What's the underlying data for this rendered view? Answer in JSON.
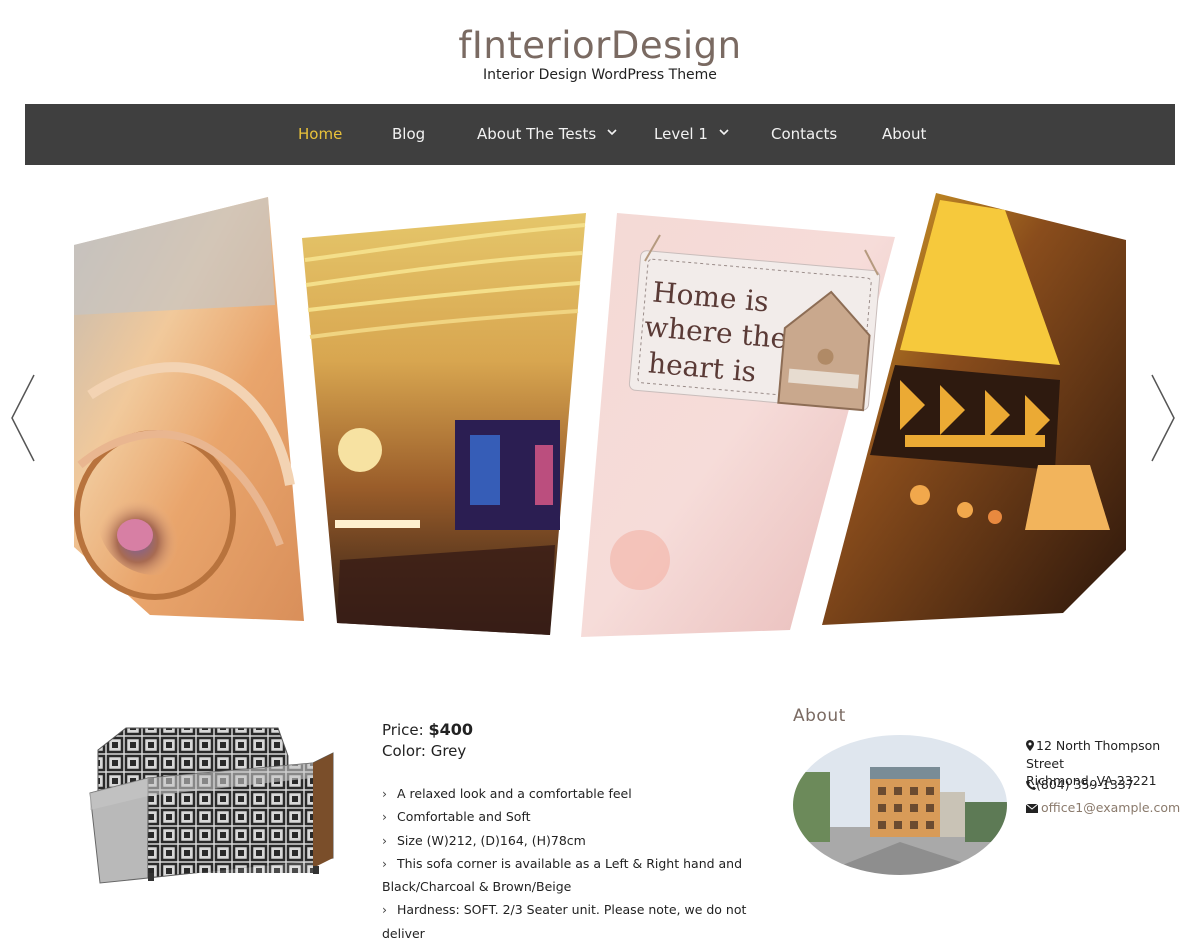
{
  "site": {
    "title": "fInteriorDesign",
    "tagline": "Interior Design WordPress Theme"
  },
  "nav": {
    "items": [
      {
        "label": "Home",
        "active": true
      },
      {
        "label": "Blog"
      },
      {
        "label": "About The Tests",
        "has_submenu": true
      },
      {
        "label": "Level 1",
        "has_submenu": true
      },
      {
        "label": "Contacts"
      },
      {
        "label": "About"
      }
    ]
  },
  "slider": {
    "slides": [
      {
        "name": "spiral-staircase-image"
      },
      {
        "name": "wavy-ceiling-hallway-image"
      },
      {
        "name": "home-sign-image",
        "sign_text": [
          "Home is",
          "where the",
          "heart is"
        ]
      },
      {
        "name": "stained-glass-lamp-image"
      }
    ],
    "prev_icon": "chevron-left-icon",
    "next_icon": "chevron-right-icon"
  },
  "product": {
    "price_label": "Price:",
    "price_value": "$400",
    "color": "Color: Grey",
    "features": [
      "A relaxed look and a comfortable feel",
      "Comfortable and Soft",
      "Size (W)212, (D)164, (H)78cm",
      "This sofa corner is available as a Left & Right hand and",
      "Black/Charcoal & Brown/Beige",
      "Hardness: SOFT. 2/3 Seater unit. Please note, we do not deliver"
    ]
  },
  "about": {
    "title": "About",
    "address_line1": "12 North Thompson Street",
    "address_line2": "Richmond, VA 23221",
    "phone": "(804) 359-1337",
    "email": "office1@example.com"
  },
  "colors": {
    "nav_bg": "#3f3f3f",
    "nav_active": "#e9c23a",
    "title": "#7a6a62",
    "link": "#8a7a6c"
  }
}
